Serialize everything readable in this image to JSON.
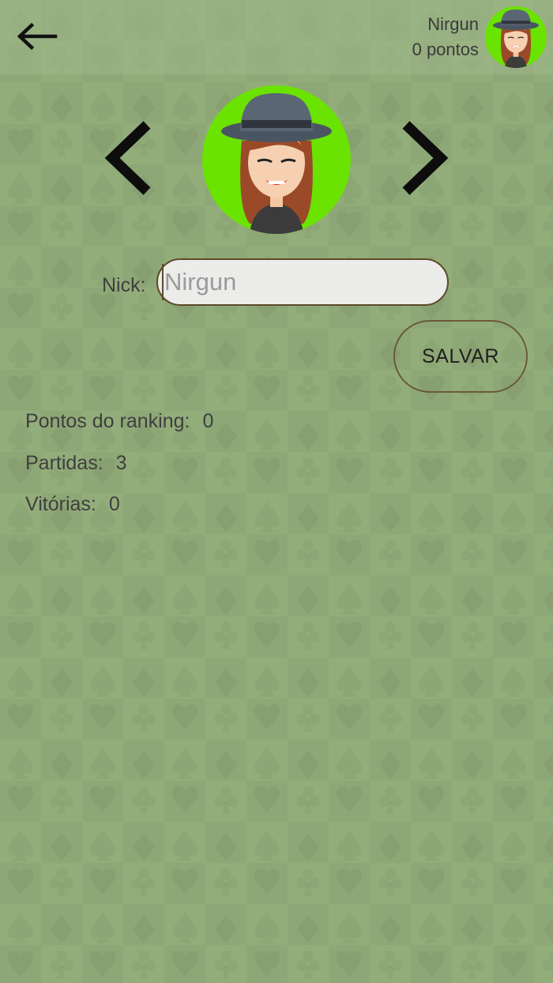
{
  "header": {
    "user_name": "Nirgun",
    "user_points": "0 pontos",
    "back_icon": "arrow-left-icon"
  },
  "profile": {
    "prev_icon": "chevron-left-icon",
    "next_icon": "chevron-right-icon",
    "avatar": "woman-with-hat-avatar",
    "avatar_bg_color": "#6ae300"
  },
  "form": {
    "nick_label": "Nick:",
    "nick_value": "",
    "nick_placeholder": "Nirgun",
    "save_label": "SALVAR"
  },
  "stats": [
    {
      "label": "Pontos do ranking:",
      "value": "0"
    },
    {
      "label": "Partidas:",
      "value": "3"
    },
    {
      "label": "Vitórias:",
      "value": "0"
    }
  ],
  "colors": {
    "background": "#93ad7a",
    "input_border": "#5b4a2b",
    "text": "#3f3f3f"
  }
}
